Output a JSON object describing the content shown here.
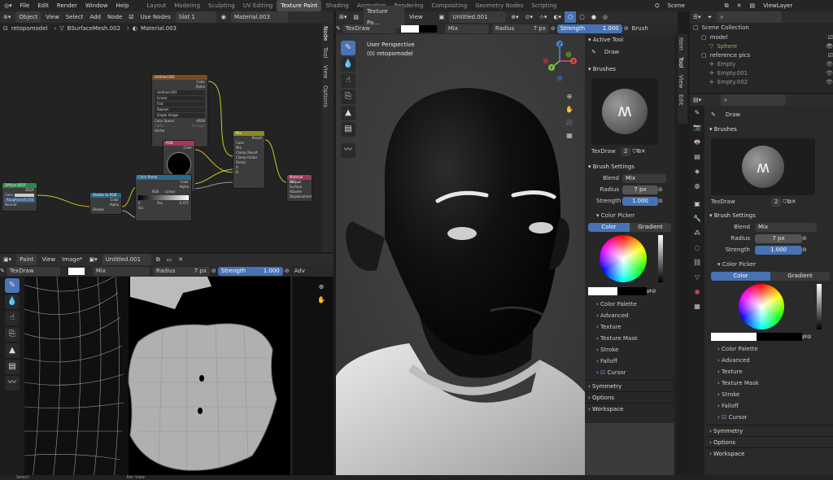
{
  "menu": {
    "items": [
      "File",
      "Edit",
      "Render",
      "Window",
      "Help"
    ]
  },
  "workspaces": [
    "Layout",
    "Modeling",
    "Sculpting",
    "UV Editing",
    "Texture Paint",
    "Shading",
    "Animation",
    "Rendering",
    "Compositing",
    "Geometry Nodes",
    "Scripting"
  ],
  "active_workspace": "Texture Paint",
  "scene": {
    "name": "Scene",
    "view_layer": "ViewLayer"
  },
  "node_editor": {
    "mode": "Object",
    "menus": [
      "View",
      "Select",
      "Add",
      "Node"
    ],
    "use_nodes": "Use Nodes",
    "slot": "Slot 1",
    "material": "Material.003",
    "breadcrumb": [
      "retopomodel",
      "BSurfaceMesh.002",
      "Material.003"
    ],
    "side_tabs": [
      "Node",
      "Tool",
      "View",
      "Options"
    ],
    "nodes": {
      "image_tex": {
        "title": "Untitled.001",
        "rows": [
          "Color",
          "Alpha",
          "Untitled.001",
          "Linear",
          "Flat",
          "Repeat",
          "Single Image",
          "Color Space",
          "sRGB",
          "Alpha",
          "Straight",
          "Vector"
        ]
      },
      "rgb": {
        "title": "RGB",
        "rows": [
          "Color"
        ]
      },
      "mix": {
        "title": "Mix",
        "rows": [
          "Result",
          "Color",
          "Mix",
          "Clamp Result",
          "Clamp Factor",
          "Factor",
          "A",
          "B"
        ]
      },
      "color_ramp": {
        "title": "Color Ramp",
        "rows": [
          "Color",
          "Alpha",
          "RGB",
          "Linear",
          "0",
          "Pos",
          "0.471",
          "Fac"
        ]
      },
      "shader_rgb": {
        "title": "Shader to RGB",
        "rows": [
          "Color",
          "Alpha",
          "Shader"
        ]
      },
      "diffuse": {
        "title": "Diffuse BSDF",
        "rows": [
          "BSDF",
          "Color",
          "Roughness",
          "0.500",
          "Normal"
        ]
      },
      "output": {
        "title": "Material Output",
        "rows": [
          "All",
          "Surface",
          "Volume",
          "Displacement"
        ]
      }
    }
  },
  "image_editor": {
    "mode": "Paint",
    "menus": [
      "View",
      "Image*"
    ],
    "image": "Untitled.001",
    "brush": "TexDraw",
    "blend": "Mix",
    "radius_label": "Radius",
    "radius": "7 px",
    "strength_label": "Strength",
    "strength": "1.000",
    "adv": "Adv"
  },
  "viewport": {
    "mode": "Texture Pa...",
    "menus": [
      "View"
    ],
    "image": "Untitled.001",
    "brush": "TexDraw",
    "blend": "Mix",
    "radius_label": "Radius",
    "radius": "7 px",
    "strength_label": "Strength",
    "strength": "1.000",
    "brush_menu": "Brush",
    "overlay_title": "User Perspective",
    "overlay_object": "(0) retopomodel",
    "side_tabs": [
      "Item",
      "Tool",
      "View",
      "Edit"
    ]
  },
  "tool_panel": {
    "active_tool": "Active Tool",
    "tool": "Draw",
    "brushes": "Brushes",
    "brush_name": "TexDraw",
    "brush_users": "2",
    "brush_settings": "Brush Settings",
    "blend_label": "Blend",
    "blend": "Mix",
    "radius_label": "Radius",
    "radius": "7 px",
    "strength_label": "Strength",
    "strength": "1.000",
    "color_picker": "Color Picker",
    "color_tab": "Color",
    "gradient_tab": "Gradient",
    "subpanels": [
      "Color Palette",
      "Advanced",
      "Texture",
      "Texture Mask",
      "Stroke",
      "Falloff",
      "Cursor"
    ],
    "bottom": [
      "Symmetry",
      "Options",
      "Workspace"
    ]
  },
  "outliner": {
    "title": "Scene Collection",
    "items": [
      {
        "name": "model",
        "indent": 0
      },
      {
        "name": "Sphere",
        "indent": 1
      },
      {
        "name": "reference pics",
        "indent": 0
      },
      {
        "name": "Empty",
        "indent": 1
      },
      {
        "name": "Empty.001",
        "indent": 1
      },
      {
        "name": "Empty.002",
        "indent": 1
      }
    ]
  },
  "properties": {
    "tool": "Draw",
    "brushes": "Brushes",
    "brush_name": "TexDraw",
    "brush_users": "2",
    "brush_settings": "Brush Settings",
    "blend_label": "Blend",
    "blend": "Mix",
    "radius_label": "Radius",
    "radius": "7 px",
    "strength_label": "Strength",
    "strength": "1.000",
    "color_picker": "Color Picker",
    "color_tab": "Color",
    "gradient_tab": "Gradient",
    "subpanels": [
      "Color Palette",
      "Advanced",
      "Texture",
      "Texture Mask",
      "Stroke",
      "Falloff",
      "Cursor"
    ],
    "bottom": [
      "Symmetry",
      "Options",
      "Workspace"
    ]
  },
  "statusbar": {
    "left": "Select",
    "mid": "Pan View"
  },
  "colors": {
    "accent": "#4772b3",
    "bg": "#1d1d1d",
    "header": "#2d2d2d"
  }
}
